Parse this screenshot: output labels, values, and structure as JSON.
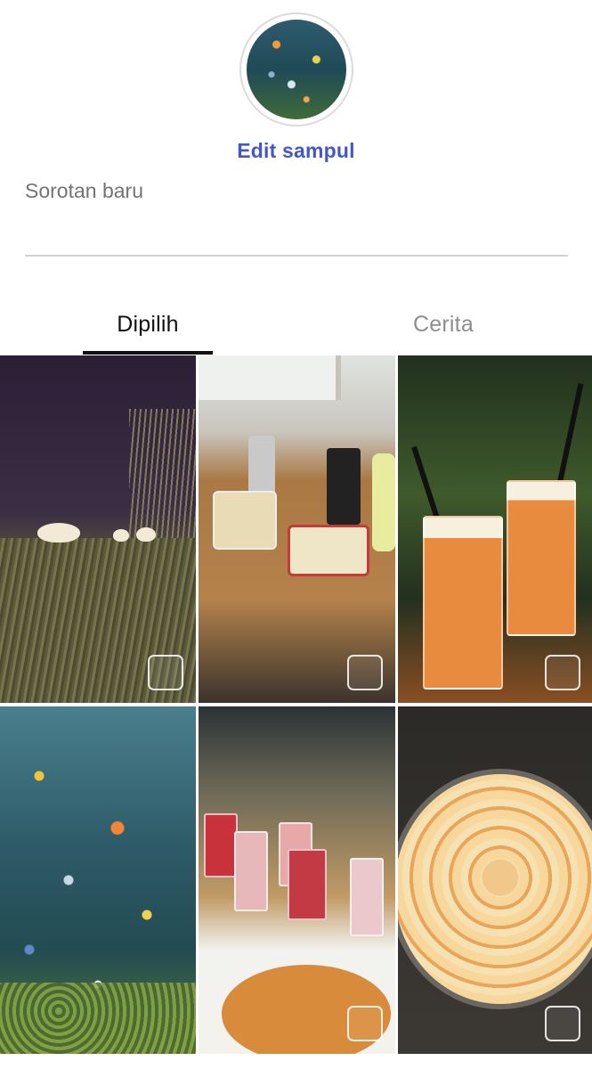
{
  "cover": {
    "edit_label": "Edit sampul"
  },
  "name_field": {
    "placeholder": "Sorotan baru",
    "value": ""
  },
  "tabs": [
    {
      "label": "Dipilih",
      "selected": true
    },
    {
      "label": "Cerita",
      "selected": false
    }
  ],
  "photos": [
    {
      "subject": "white geese on grass at night",
      "selected": false
    },
    {
      "subject": "table with food boxes and drinks",
      "selected": false
    },
    {
      "subject": "two orange smoothies with whipped cream",
      "selected": false
    },
    {
      "subject": "aquarium with colorful fish",
      "selected": false
    },
    {
      "subject": "glasses of drinks and bowl of soup",
      "selected": false
    },
    {
      "subject": "apple rose tart in baking pan",
      "selected": false
    }
  ],
  "colors": {
    "accent": "#4457c7",
    "tab_active": "#111111",
    "tab_inactive": "#8e8e8e"
  }
}
